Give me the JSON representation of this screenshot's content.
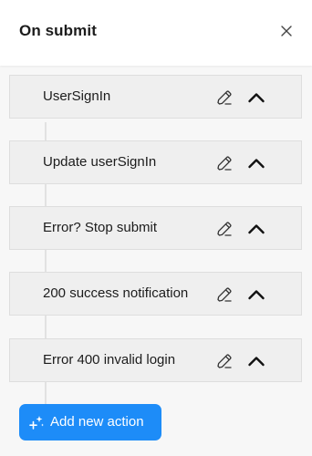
{
  "header": {
    "title": "On submit",
    "close_icon": "close-icon"
  },
  "actions": [
    {
      "label": "UserSignIn",
      "edit_icon": "pencil-icon",
      "toggle_icon": "chevron-up-icon"
    },
    {
      "label": "Update userSignIn",
      "edit_icon": "pencil-icon",
      "toggle_icon": "chevron-up-icon"
    },
    {
      "label": "Error? Stop submit",
      "edit_icon": "pencil-icon",
      "toggle_icon": "chevron-up-icon"
    },
    {
      "label": "200 success notification",
      "edit_icon": "pencil-icon",
      "toggle_icon": "chevron-up-icon"
    },
    {
      "label": "Error 400 invalid login",
      "edit_icon": "pencil-icon",
      "toggle_icon": "chevron-up-icon"
    }
  ],
  "add_button": {
    "label": "Add new action",
    "icon": "sparkle-icon"
  },
  "colors": {
    "accent": "#1d8cf8",
    "card_bg": "#efefef",
    "card_border": "#dedede"
  }
}
